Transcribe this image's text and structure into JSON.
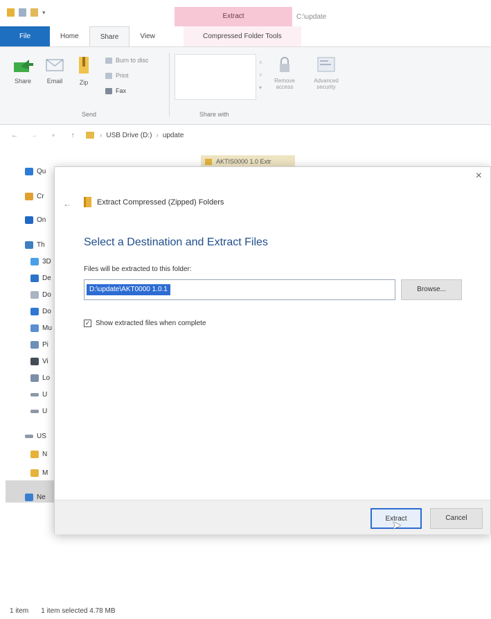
{
  "title_bar": {
    "context_tab": "Extract",
    "window_title": "C:\\update"
  },
  "ribbon_tabs": {
    "file": "File",
    "home": "Home",
    "share": "Share",
    "view": "View",
    "compressed_tools": "Compressed Folder Tools"
  },
  "ribbon": {
    "share_label": "Share",
    "email_label": "Email",
    "zip_label": "Zip",
    "burn_to_disc": "Burn to disc",
    "print": "Print",
    "fax": "Fax",
    "send_group": "Send",
    "share_with_group": "Share with",
    "remove_access": "Remove access",
    "advanced_security": "Advanced security"
  },
  "address_bar": {
    "crumbs": [
      "USB Drive (D:)",
      "update"
    ]
  },
  "sidebar": {
    "items": [
      "Qu",
      "Cr",
      "On",
      "Th",
      "3D",
      "De",
      "Do",
      "Do",
      "Mu",
      "Pi",
      "Vi",
      "Lo",
      "U",
      "U",
      "US",
      "N",
      "M",
      "Ne"
    ]
  },
  "background_file": "AKTIS0000 1.0 Extr",
  "dialog": {
    "title": "Extract Compressed (Zipped) Folders",
    "heading": "Select a Destination and Extract Files",
    "files_label": "Files will be extracted to this folder:",
    "path_value": "D:\\update\\AKT0000 1.0.1",
    "browse_button": "Browse...",
    "checkbox_label": "Show extracted files when complete",
    "checkbox_checked": true,
    "extract_button": "Extract",
    "cancel_button": "Cancel"
  },
  "status_bar": {
    "items_count": "1 item",
    "selected": "1 item selected  4.78 MB"
  },
  "colors": {
    "file_tab": "#1e6fc0",
    "context_tab": "#f7c7d6",
    "selection": "#2d6cd2",
    "heading": "#1f4e8c"
  }
}
